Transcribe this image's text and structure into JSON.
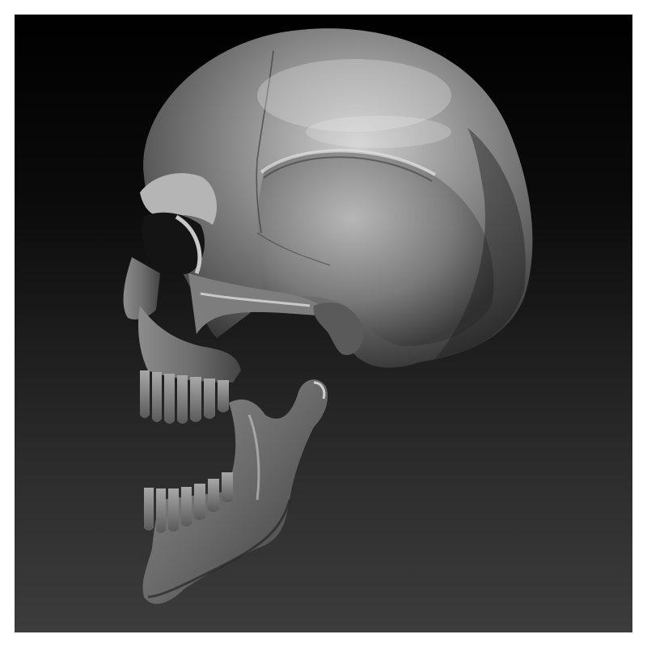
{
  "scene": {
    "subject": "skull-sculpt",
    "colors": {
      "frame": "#ffffff",
      "background_top": "#000000",
      "background_bottom": "#3c3c3c",
      "material_base": "#6e6e6e",
      "material_highlight": "#d6d6d6",
      "material_shadow": "#262626"
    }
  }
}
